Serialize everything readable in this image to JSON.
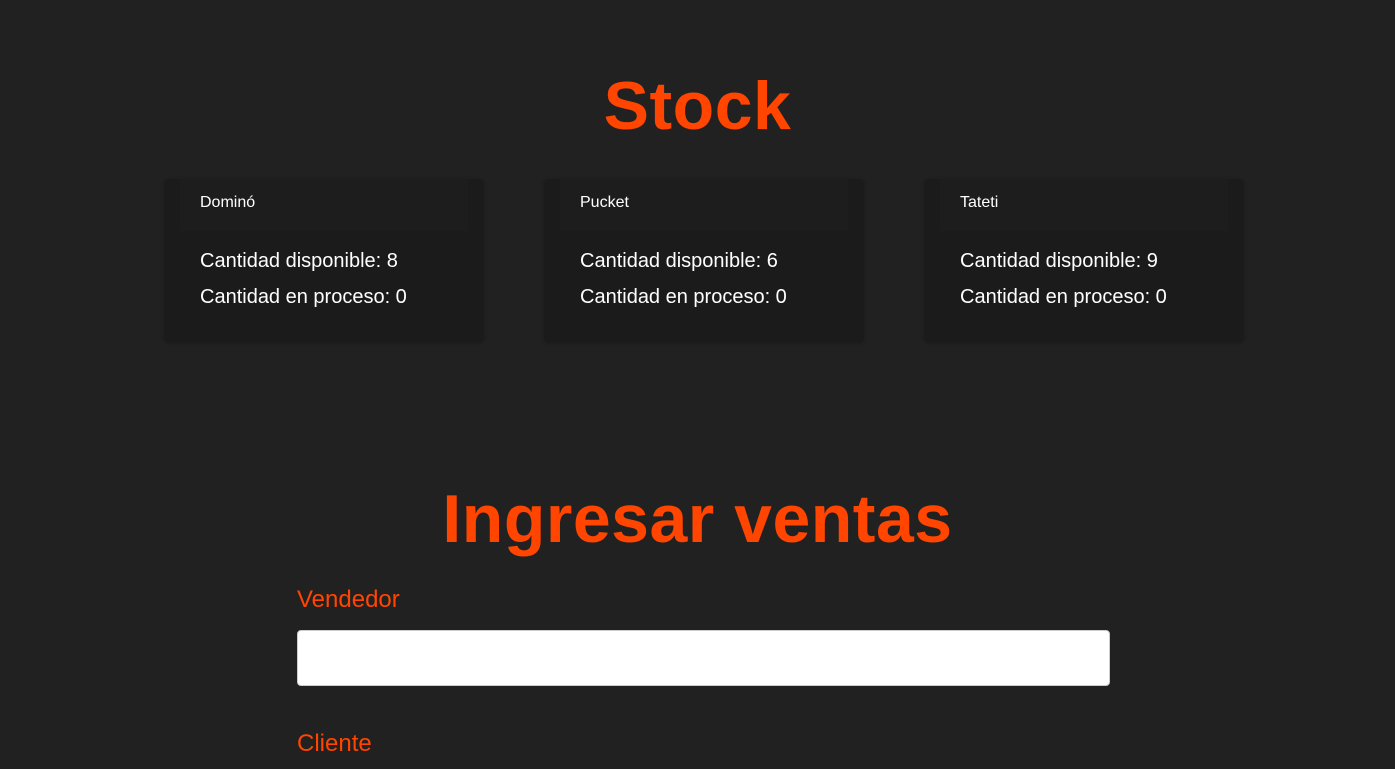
{
  "stock": {
    "title": "Stock",
    "products": [
      {
        "name": "Dominó",
        "available": "Cantidad disponible: 8",
        "in_process": "Cantidad en proceso: 0"
      },
      {
        "name": "Pucket",
        "available": "Cantidad disponible: 6",
        "in_process": "Cantidad en proceso: 0"
      },
      {
        "name": "Tateti",
        "available": "Cantidad disponible: 9",
        "in_process": "Cantidad en proceso: 0"
      }
    ]
  },
  "sales": {
    "title": "Ingresar ventas",
    "fields": {
      "vendedor": {
        "label": "Vendedor",
        "value": "",
        "placeholder": ""
      },
      "cliente": {
        "label": "Cliente"
      }
    }
  },
  "colors": {
    "background": "#212121",
    "accent": "#ff4500",
    "card": "#1b1b1b",
    "text": "#ffffff"
  }
}
